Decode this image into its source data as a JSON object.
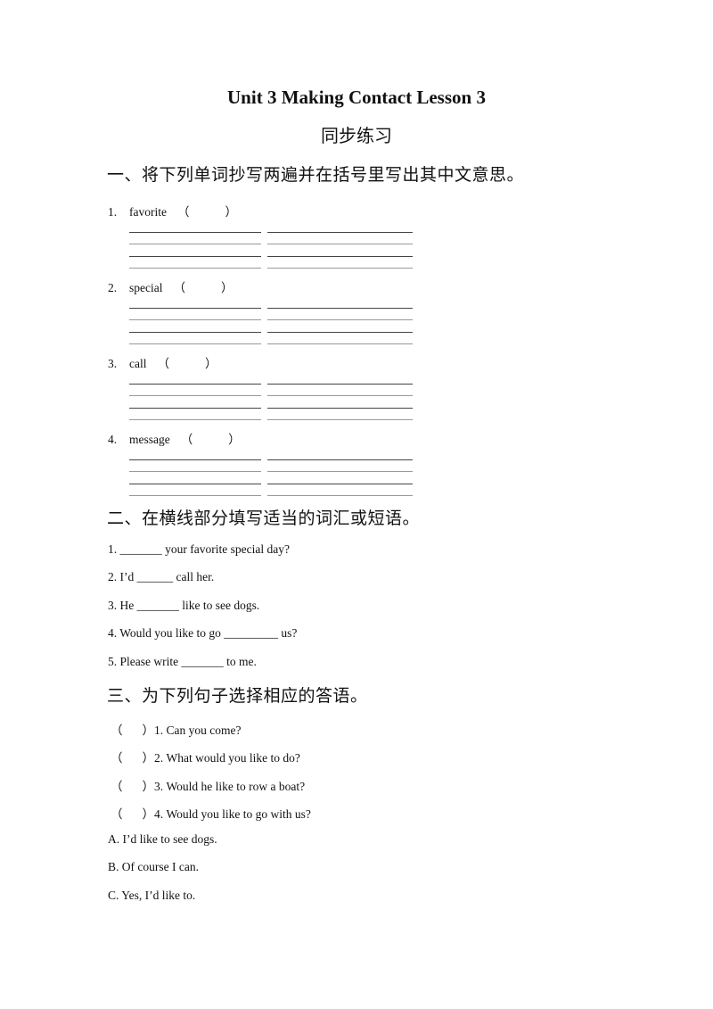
{
  "title": "Unit 3 Making Contact Lesson 3",
  "subtitle": "同步练习",
  "section1": {
    "heading": "一、将下列单词抄写两遍并在括号里写出其中文意思。",
    "items": [
      {
        "num": "1.",
        "word": "favorite",
        "paren_open": "（",
        "paren_close": "）"
      },
      {
        "num": "2.",
        "word": "special",
        "paren_open": "（",
        "paren_close": "）"
      },
      {
        "num": "3.",
        "word": "call",
        "paren_open": "（",
        "paren_close": "）"
      },
      {
        "num": "4.",
        "word": "message",
        "paren_open": "（",
        "paren_close": "）"
      }
    ]
  },
  "section2": {
    "heading": "二、在横线部分填写适当的词汇或短语。",
    "items": [
      {
        "before": "1. ",
        "blank": "_______",
        "after": " your favorite special day?"
      },
      {
        "before": "2. I’d ",
        "blank": "______",
        "after": " call her."
      },
      {
        "before": "3. He ",
        "blank": "_______",
        "after": " like to see dogs."
      },
      {
        "before": "4. Would you like to go ",
        "blank": "_________",
        "after": " us?"
      },
      {
        "before": "5. Please write ",
        "blank": "_______",
        "after": " to me."
      }
    ]
  },
  "section3": {
    "heading": "三、为下列句子选择相应的答语。",
    "questions": [
      {
        "paren_open": "（",
        "paren_close": "）",
        "text": "1. Can you come?"
      },
      {
        "paren_open": "（",
        "paren_close": "）",
        "text": "2. What would you like to do?"
      },
      {
        "paren_open": "（",
        "paren_close": "）",
        "text": "3. Would he like to row a boat?"
      },
      {
        "paren_open": "（",
        "paren_close": "）",
        "text": "4. Would you like to go with us?"
      }
    ],
    "answers": [
      {
        "text": "A. I’d like to see dogs."
      },
      {
        "text": "B. Of course I can."
      },
      {
        "text": "C. Yes, I’d like to."
      }
    ]
  }
}
